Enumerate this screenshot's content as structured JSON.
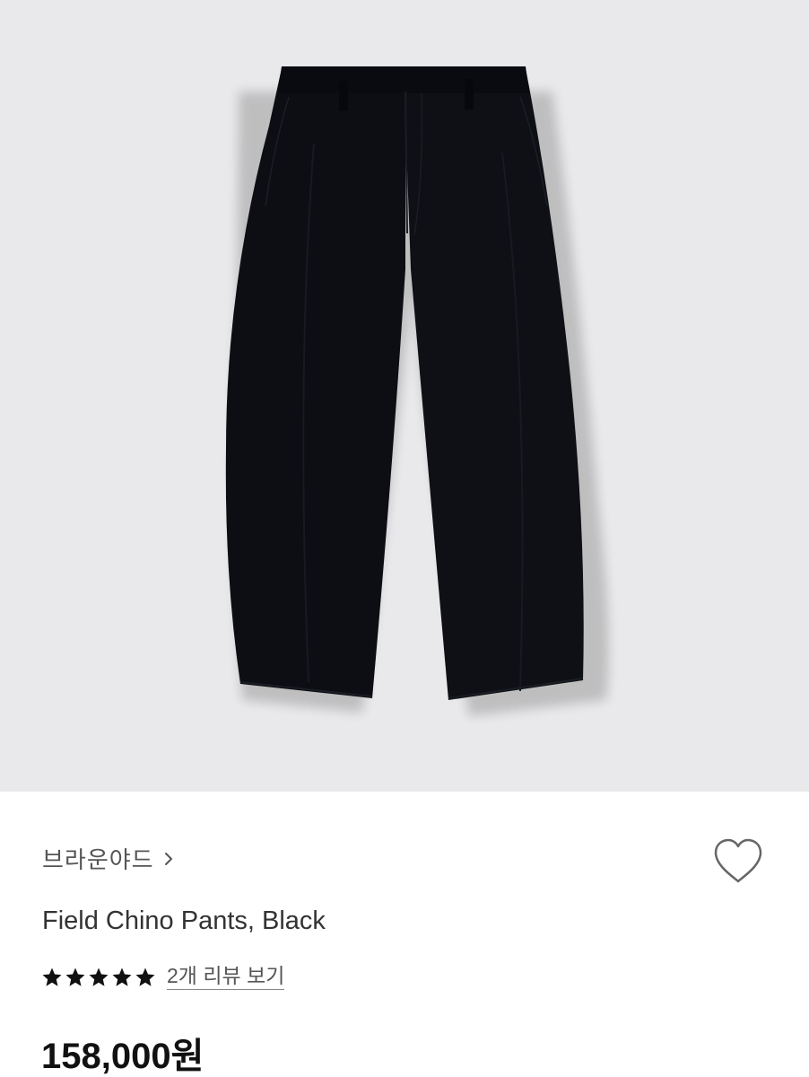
{
  "product": {
    "image_icon": "black-pants-photo",
    "image_bg_color": "#e9e9eb",
    "brand": "브라운야드",
    "name": "Field Chino Pants, Black",
    "rating_stars": 5,
    "rating_max": 5,
    "review_link": "2개 리뷰 보기",
    "price": "158,000원"
  },
  "actions": {
    "wishlist_icon": "heart-outline-icon"
  },
  "colors": {
    "star": "#111111",
    "price": "#111111",
    "brand_text": "#555555"
  }
}
